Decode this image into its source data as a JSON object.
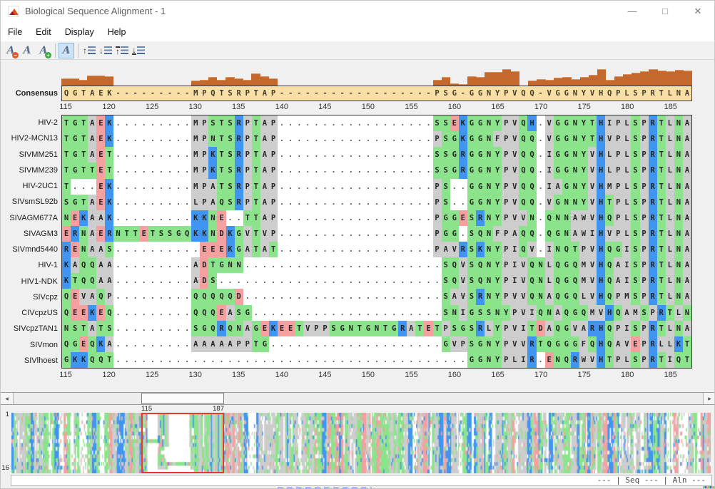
{
  "window": {
    "title": "Biological Sequence Alignment - 1",
    "controls": {
      "minimize": "—",
      "maximize": "□",
      "close": "✕"
    }
  },
  "menu": {
    "items": [
      {
        "label": "File"
      },
      {
        "label": "Edit"
      },
      {
        "label": "Display"
      },
      {
        "label": "Help"
      }
    ]
  },
  "toolbar": {
    "buttons": [
      {
        "name": "decrease-fontsize",
        "type": "font",
        "glyph": "A",
        "badge": "−",
        "badge_color": "#e4572e"
      },
      {
        "name": "original-fontsize",
        "type": "font",
        "glyph": "A"
      },
      {
        "name": "increase-fontsize",
        "type": "font",
        "glyph": "A",
        "badge": "+",
        "badge_color": "#3faa3f"
      },
      {
        "name": "fit-to-window",
        "type": "font",
        "glyph": "A",
        "selected": true,
        "group_end": true
      },
      {
        "name": "move-sequence-up",
        "type": "arrow",
        "glyph": "↑"
      },
      {
        "name": "move-sequence-down",
        "type": "arrow",
        "glyph": "↓"
      },
      {
        "name": "move-sequence-top",
        "type": "arrow",
        "glyph": "↑",
        "line": "top"
      },
      {
        "name": "move-sequence-bottom",
        "type": "arrow",
        "glyph": "↓",
        "line": "bottom"
      }
    ]
  },
  "alignment": {
    "start": 115,
    "end": 187,
    "consensus_label": "Consensus",
    "ruler_ticks": [
      115,
      120,
      125,
      130,
      135,
      140,
      145,
      150,
      155,
      160,
      165,
      170,
      175,
      180,
      185
    ],
    "consensus": "QGTAEK---------MPQTSRPTAP------------------PSG-GGNYPVQQ-VGGNYVHQPLSPRTLNA",
    "consensus_histogram": [
      0.42,
      0.42,
      0.33,
      0.58,
      0.6,
      0.55,
      0,
      0,
      0,
      0,
      0,
      0,
      0,
      0,
      0,
      0.28,
      0.3,
      0.5,
      0.33,
      0.48,
      0.4,
      0.33,
      0.72,
      0.55,
      0.4,
      0,
      0,
      0,
      0,
      0,
      0,
      0,
      0,
      0,
      0,
      0,
      0,
      0,
      0,
      0,
      0,
      0,
      0,
      0.33,
      0.5,
      0.07,
      0.05,
      0.55,
      0.5,
      0.8,
      0.82,
      1.0,
      0.85,
      0,
      0.25,
      0.35,
      0.3,
      0.45,
      0.5,
      0.35,
      0.5,
      0.65,
      1.0,
      0.3,
      0.55,
      0.68,
      0.78,
      0.88,
      1.0,
      0.92,
      0.88,
      0.95,
      0.92
    ],
    "palette": {
      "green": "#8be48b",
      "gray": "#cdcdcd",
      "blue": "#4095f0",
      "red": "#f4a0a0"
    },
    "letter_class": {
      "G": "green",
      "S": "green",
      "T": "green",
      "Y": "green",
      "N": "green",
      "Q": "green",
      "C": "green",
      "A": "gray",
      "V": "gray",
      "L": "gray",
      "I": "gray",
      "P": "gray",
      "M": "gray",
      "F": "gray",
      "W": "gray",
      "K": "blue",
      "R": "blue",
      "H": "blue",
      "D": "red",
      "E": "red"
    },
    "sequences": [
      {
        "name": "HIV-2",
        "residues": "TGTAEK.........MPSTSRPTAP..................SSEKGGNYPVQH.VGGNYTHIPLSPRTLNA"
      },
      {
        "name": "HIV2-MCN13",
        "residues": "TGTAEK.........MPNTSRPTAP..................PSGKGGNFPVQQ.VGGNYTHVPLSPRTLNA"
      },
      {
        "name": "SIVMM251",
        "residues": "TGTAET.........MPKTSRPTAP..................SSGRGGNYPVQQ.IGGNYVHLPLSPRTLNA"
      },
      {
        "name": "SIVMM239",
        "residues": "TGTTET.........MPKTSRPTAP..................SSGRGGNYPVQQ.IGGNYVHLPLSPRTLNA"
      },
      {
        "name": "HIV-2UC1",
        "residues": "T...EK.........MPATSRPTAP..................PS..GGNYPVQQ.IAGNYVHMPLSPRTLNA"
      },
      {
        "name": "SIVsmSL92b",
        "residues": "SGTAEK.........LPAQSRPTAP..................PS..GGNYPVQQ.VGNNYVHTPLSPRTLNA"
      },
      {
        "name": "SIVAGM677A",
        "residues": "NEKAAK.........KKNE..TTAP..................PGGESRNYPVVN.QNNAWVHQPLSPRTLNA"
      },
      {
        "name": "SIVAGM3",
        "residues": "ERNAERNTTETSSGQKKNDKGVTVP..................PGG.SQNFPAQQ.QGNAWIHVPLSPRTLNA"
      },
      {
        "name": "SIVmnd5440",
        "residues": "RENAAS..........EEEKGATAT..................PAVRSKNYPIQV.INQTPVHQGISPRTLNA"
      },
      {
        "name": "HIV-1",
        "residues": "KAQQAA.........ADTGNN.......................SQVSQNYPIVQNLQGQMVHQAISPRTLNA"
      },
      {
        "name": "HIV1-NDK",
        "residues": "KTQQAA.........ADS..........................SQVSQNYPIVQNLQGQMVHQAISPRTLNA"
      },
      {
        "name": "SIVcpz",
        "residues": "QEVAQP.........QQQQQD.......................SAVSRNYPVVQNAQGQLVHQPMSPRTLNA"
      },
      {
        "name": "CIVcpzUS",
        "residues": "QEEKEQ.........QQQEASG......................SNIGSSNYPVIQNAQGQMVHQAMSPRTLNA"
      },
      {
        "name": "SIVcpzTAN1",
        "residues": "NSTATS.........SGQRQNAGEKEETVPPSGNTGNTGRATETPSGSRLYPVITDAQGVARHQPISPRTLNA"
      },
      {
        "name": "SIVmon",
        "residues": "QGEQKA.........AAAAAPPTG....................GVPSGNYPVVRTQGGGFQHQAVEPRLLKT"
      },
      {
        "name": "SIVlhoest",
        "residues": "GKKQQT.........................................GGNYPLIR.ENQRWVHTPLSPRTIQT"
      }
    ]
  },
  "scrollbar": {
    "left_label": "115",
    "right_label": "187",
    "left_arrow": "◂",
    "right_arrow": "▸"
  },
  "overview": {
    "top_label": "1",
    "bottom_label": "16"
  },
  "status": {
    "text": "--- | Seq --- | Aln ---"
  }
}
